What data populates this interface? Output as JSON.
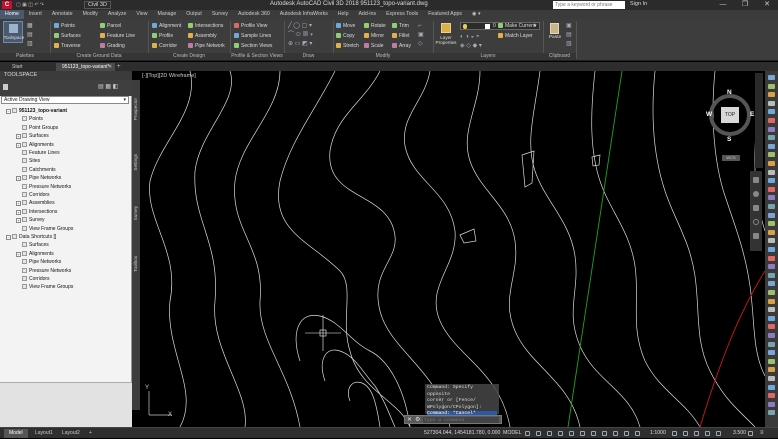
{
  "app": {
    "quick_tab": "Civil 3D",
    "title": "Autodesk AutoCAD Civil 3D 2018    951123_topo-variant.dwg",
    "search_placeholder": "Type a keyword or phrase",
    "sign_in": "Sign In"
  },
  "ribbon_tabs": [
    "Home",
    "Insert",
    "Annotate",
    "Modify",
    "Analyze",
    "View",
    "Manage",
    "Output",
    "Survey",
    "Autodesk 360",
    "Autodesk InfraWorks",
    "Help",
    "Add-ins",
    "Express Tools",
    "Featured Apps"
  ],
  "ribbon": {
    "toolspace_btn": "Toolspace",
    "ground": [
      "Points",
      "Surfaces",
      "Traverse"
    ],
    "ground2": [
      "Parcel",
      "Feature Line",
      "Grading"
    ],
    "design": [
      "Alignment",
      "Profile",
      "Corridor"
    ],
    "design2": [
      "Intersections",
      "Assembly",
      "Pipe Network"
    ],
    "views": [
      "Profile View",
      "Sample Lines",
      "Section Views"
    ],
    "modify": [
      "Move",
      "Copy",
      "Stretch"
    ],
    "modify2": [
      "Rotate",
      "Mirror",
      "Scale"
    ],
    "modify3": [
      "Trim",
      "Fillet",
      "Array"
    ],
    "layers_btn": "Layer Properties",
    "layer_value": "0",
    "layers2": [
      "Make Current",
      "Match Layer"
    ],
    "paste": "Paste",
    "panels": [
      "Palettes",
      "Create Ground Data",
      "Create Design",
      "Profile & Section Views",
      "Draw",
      "Modify",
      "Layers",
      "Clipboard"
    ]
  },
  "doc_tabs": [
    "Start",
    "951123_topo-variant*"
  ],
  "toolspace": {
    "header": "TOOLSPACE",
    "dropdown": "Active Drawing View",
    "side_tabs": [
      "Prospector",
      "Settings",
      "Survey",
      "Toolbox"
    ],
    "tree": [
      {
        "label": "951123_topo-variant",
        "bold": true
      },
      {
        "label": "Points"
      },
      {
        "label": "Point Groups"
      },
      {
        "label": "Surfaces"
      },
      {
        "label": "Alignments"
      },
      {
        "label": "Feature Lines"
      },
      {
        "label": "Sites"
      },
      {
        "label": "Catchments"
      },
      {
        "label": "Pipe Networks"
      },
      {
        "label": "Pressure Networks"
      },
      {
        "label": "Corridors"
      },
      {
        "label": "Assemblies"
      },
      {
        "label": "Intersections"
      },
      {
        "label": "Survey"
      },
      {
        "label": "View Frame Groups"
      },
      {
        "label": "Data Shortcuts []"
      },
      {
        "label": "Surfaces"
      },
      {
        "label": "Alignments"
      },
      {
        "label": "Pipe Networks"
      },
      {
        "label": "Pressure Networks"
      },
      {
        "label": "Corridors"
      },
      {
        "label": "View Frame Groups"
      }
    ]
  },
  "viewport": {
    "label": "[-][Top][2D Wireframe]",
    "compass": {
      "n": "N",
      "s": "S",
      "e": "E",
      "w": "W",
      "top": "TOP",
      "ucs": "WCS"
    }
  },
  "command": {
    "history": [
      "Command: Specify opposite",
      "corner or [Fence/",
      "WPolygon/CPolygon]:"
    ],
    "last": "Command: *Cancel*",
    "placeholder": "Type a command"
  },
  "status": {
    "layout_tabs": [
      "Model",
      "Layout1",
      "Layout2"
    ],
    "coords": "527304.044, 1454181.780, 0.000",
    "model": "MODEL",
    "scale": "1:1000",
    "lw": "3.500"
  },
  "colors": {
    "accent": "#4a5a6e",
    "green_line": "#1fa31f",
    "red_line": "#d01818",
    "contour": "#dcdcdc"
  }
}
